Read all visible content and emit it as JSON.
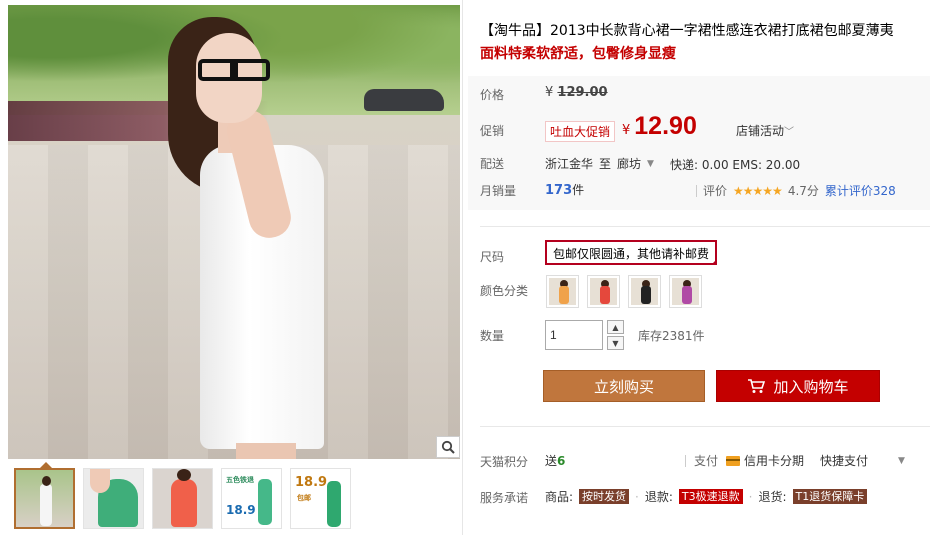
{
  "product": {
    "title": "【淘牛品】2013中长款背心裙一字裙性感连衣裙打底裙包邮夏薄夷",
    "subtitle": "面料特柔软舒适，包臀修身显瘦"
  },
  "gallery": {
    "thumbnails": [
      {
        "label": "",
        "colors": [
          "#c9d4b8",
          "#f4f4f4"
        ]
      },
      {
        "label": "",
        "colors": [
          "#e6e6e6",
          "#3fae7a"
        ]
      },
      {
        "label": "",
        "colors": [
          "#d9d4cf",
          "#f0604a"
        ]
      },
      {
        "label": "五色铁退",
        "price": "18.9",
        "colors": [
          "#ffffff",
          "#45b889"
        ]
      },
      {
        "label": "包邮",
        "price": "18.9",
        "colors": [
          "#ffffff",
          "#2fa86f"
        ]
      }
    ]
  },
  "price": {
    "label": "价格",
    "currency": "¥",
    "original": "129.00"
  },
  "promo": {
    "label": "促销",
    "badge": "吐血大促销",
    "currency": "¥",
    "price": "12.90",
    "shop_activity": "店铺活动"
  },
  "shipping": {
    "label": "配送",
    "from": "浙江金华",
    "to_word": "至",
    "to": "廊坊",
    "fee": "快递: 0.00 EMS: 20.00"
  },
  "sales": {
    "label": "月销量",
    "count": "173",
    "unit": "件",
    "rating_label": "评价",
    "stars": "★★★★★",
    "score": "4.7分",
    "reviews": "累计评价328"
  },
  "options": {
    "size_label": "尺码",
    "size_value": "包邮仅限圆通，其他请补邮费",
    "color_label": "颜色分类",
    "colors": [
      {
        "name": "orange",
        "hex": "#f0a24a"
      },
      {
        "name": "red",
        "hex": "#e5483c"
      },
      {
        "name": "black",
        "hex": "#222222"
      },
      {
        "name": "purple",
        "hex": "#b04aa5"
      }
    ],
    "qty_label": "数量",
    "qty_value": "1",
    "stock": "库存2381件"
  },
  "actions": {
    "buy_now": "立刻购买",
    "add_cart": "加入购物车"
  },
  "footer": {
    "points_label": "天猫积分",
    "points_prefix": "送",
    "points": "6",
    "pay_label": "支付",
    "pay_card": "信用卡分期",
    "pay_quick": "快捷支付",
    "service_label": "服务承诺",
    "svc1_prefix": "商品:",
    "svc1_tag": "按时发货",
    "svc2_prefix": "退款:",
    "svc2_tag": "T3极速退款",
    "svc3_prefix": "退货:",
    "svc3_tag": "T1退货保障卡"
  }
}
